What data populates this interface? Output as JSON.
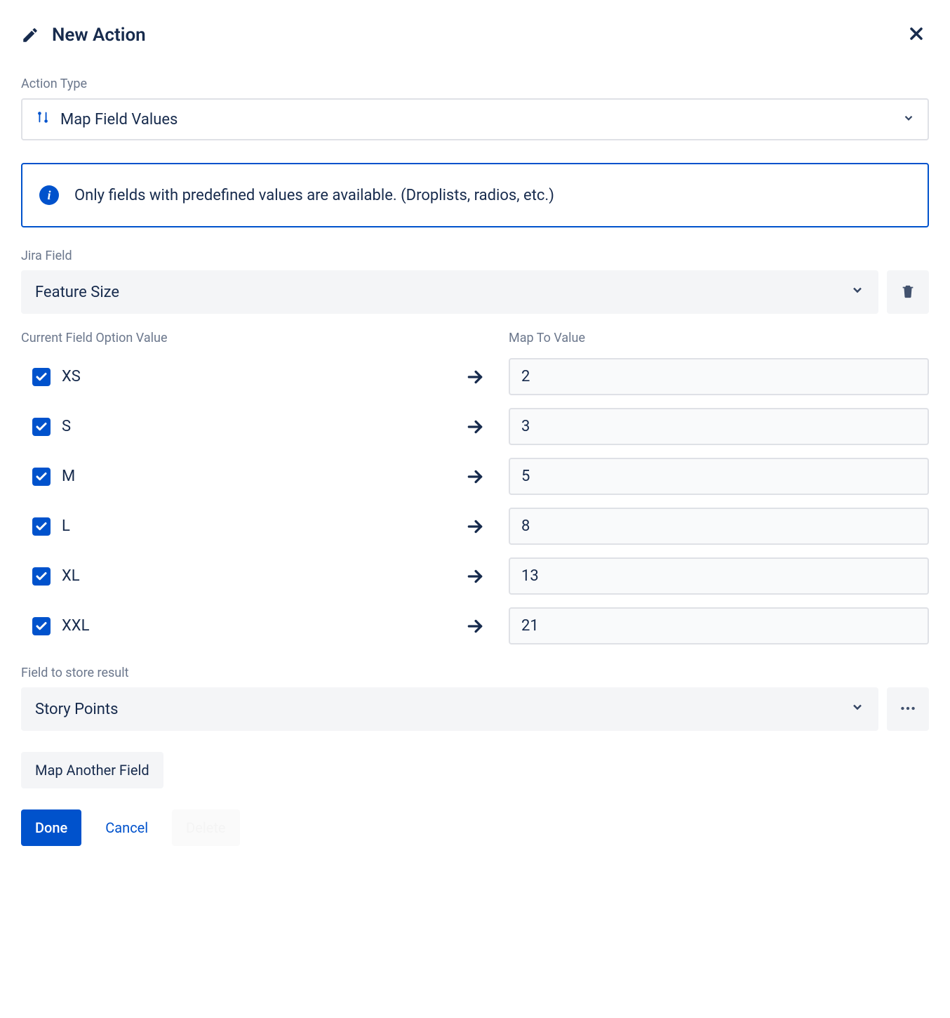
{
  "header": {
    "title": "New Action"
  },
  "action_type": {
    "label": "Action Type",
    "value": "Map Field Values"
  },
  "info": {
    "text": "Only fields with predefined values are available. (Droplists, radios, etc.)"
  },
  "jira_field": {
    "label": "Jira Field",
    "value": "Feature Size"
  },
  "columns": {
    "left_label": "Current Field Option Value",
    "right_label": "Map To Value"
  },
  "mappings": [
    {
      "checked": true,
      "option": "XS",
      "value": "2"
    },
    {
      "checked": true,
      "option": "S",
      "value": "3"
    },
    {
      "checked": true,
      "option": "M",
      "value": "5"
    },
    {
      "checked": true,
      "option": "L",
      "value": "8"
    },
    {
      "checked": true,
      "option": "XL",
      "value": "13"
    },
    {
      "checked": true,
      "option": "XXL",
      "value": "21"
    }
  ],
  "result_field": {
    "label": "Field to store result",
    "value": "Story Points"
  },
  "buttons": {
    "map_another": "Map Another Field",
    "done": "Done",
    "cancel": "Cancel",
    "delete": "Delete"
  }
}
